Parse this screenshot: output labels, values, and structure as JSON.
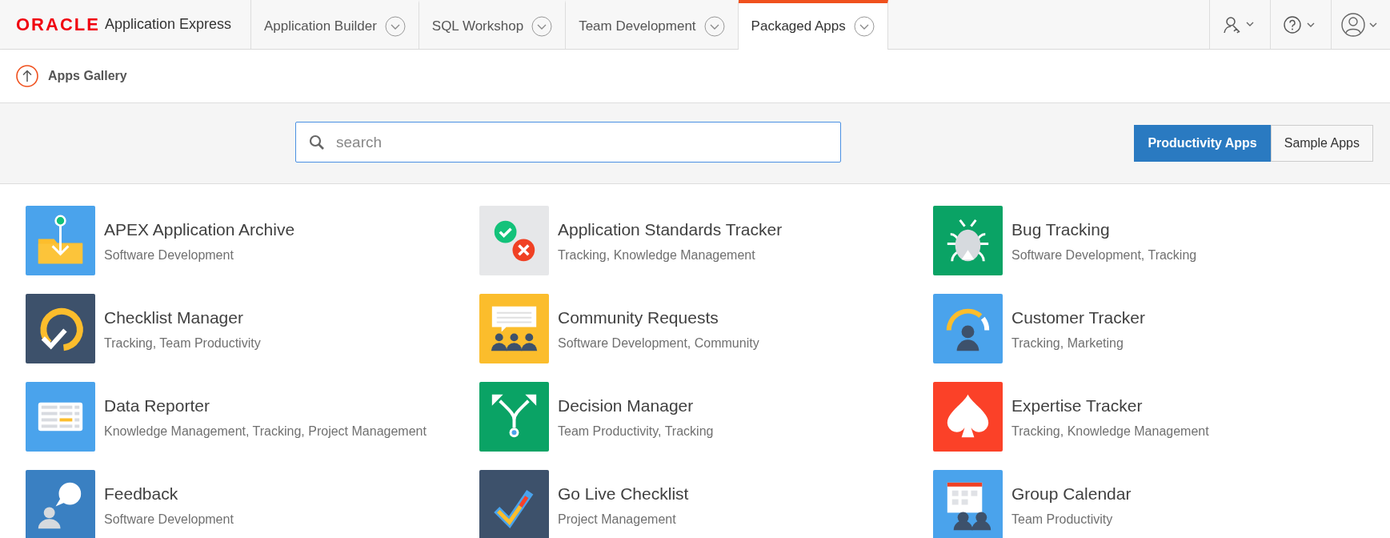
{
  "header": {
    "logo": "ORACLE",
    "product": "Application Express",
    "tabs": [
      {
        "label": "Application Builder",
        "selected": false
      },
      {
        "label": "SQL Workshop",
        "selected": false
      },
      {
        "label": "Team Development",
        "selected": false
      },
      {
        "label": "Packaged Apps",
        "selected": true
      }
    ]
  },
  "breadcrumb": {
    "title": "Apps Gallery"
  },
  "search": {
    "placeholder": "search"
  },
  "filters": [
    {
      "label": "Productivity Apps",
      "selected": true
    },
    {
      "label": "Sample Apps",
      "selected": false
    }
  ],
  "apps": [
    {
      "name": "APEX Application Archive",
      "categories": "Software Development",
      "kind": "archive",
      "color": "#4aa3ec"
    },
    {
      "name": "Application Standards Tracker",
      "categories": "Tracking, Knowledge Management",
      "kind": "standards",
      "color": "#e6e7e9"
    },
    {
      "name": "Bug Tracking",
      "categories": "Software Development, Tracking",
      "kind": "bug",
      "color": "#0aa365"
    },
    {
      "name": "Checklist Manager",
      "categories": "Tracking, Team Productivity",
      "kind": "checklist",
      "color": "#3d516b"
    },
    {
      "name": "Community Requests",
      "categories": "Software Development, Community",
      "kind": "community",
      "color": "#fbbd2c"
    },
    {
      "name": "Customer Tracker",
      "categories": "Tracking, Marketing",
      "kind": "customer",
      "color": "#4aa3ec"
    },
    {
      "name": "Data Reporter",
      "categories": "Knowledge Management, Tracking, Project Management",
      "kind": "reporter",
      "color": "#4aa3ec"
    },
    {
      "name": "Decision Manager",
      "categories": "Team Productivity, Tracking",
      "kind": "decision",
      "color": "#0aa365"
    },
    {
      "name": "Expertise Tracker",
      "categories": "Tracking, Knowledge Management",
      "kind": "expertise",
      "color": "#fb4128"
    },
    {
      "name": "Feedback",
      "categories": "Software Development",
      "kind": "feedback",
      "color": "#3a80c2"
    },
    {
      "name": "Go Live Checklist",
      "categories": "Project Management",
      "kind": "golive",
      "color": "#3d516b"
    },
    {
      "name": "Group Calendar",
      "categories": "Team Productivity",
      "kind": "calendar",
      "color": "#4aa3ec"
    }
  ]
}
